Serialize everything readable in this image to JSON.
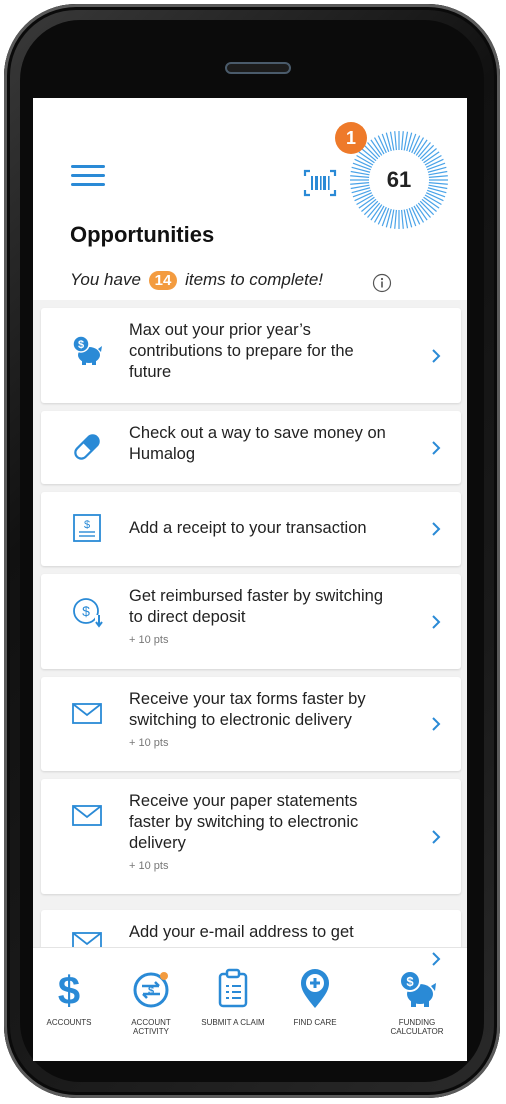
{
  "header": {
    "score": "61",
    "notification_count": "1",
    "title": "Opportunities",
    "subtitle_prefix": "You have",
    "item_count": "14",
    "subtitle_suffix": "items to complete!"
  },
  "cards": [
    {
      "icon": "piggy-bank-dollar-icon",
      "text": "Max out your prior year’s contributions to prepare for the future",
      "pts": ""
    },
    {
      "icon": "pill-icon",
      "text": "Check out a way to save money on Humalog",
      "pts": ""
    },
    {
      "icon": "receipt-icon",
      "text": "Add a receipt to your transaction",
      "pts": ""
    },
    {
      "icon": "direct-deposit-icon",
      "text": "Get reimbursed faster by switching to direct deposit",
      "pts": "+ 10 pts"
    },
    {
      "icon": "envelope-icon",
      "text": "Receive your tax forms faster by switching to electronic delivery",
      "pts": "+ 10 pts"
    },
    {
      "icon": "envelope-icon",
      "text": "Receive your paper statements faster by switching to electronic delivery",
      "pts": "+ 10 pts"
    },
    {
      "icon": "envelope-icon",
      "text": "Add your e-mail address to get",
      "pts": ""
    }
  ],
  "nav": {
    "accounts": "ACCOUNTS",
    "account_activity": "ACCOUNT ACTIVITY",
    "submit_claim": "SUBMIT A CLAIM",
    "find_care": "FIND CARE",
    "funding_calculator": "FUNDING CALCULATOR"
  },
  "colors": {
    "accent_blue": "#2a8ad6",
    "badge_orange": "#ee7a2a",
    "count_orange": "#f39b3f"
  }
}
